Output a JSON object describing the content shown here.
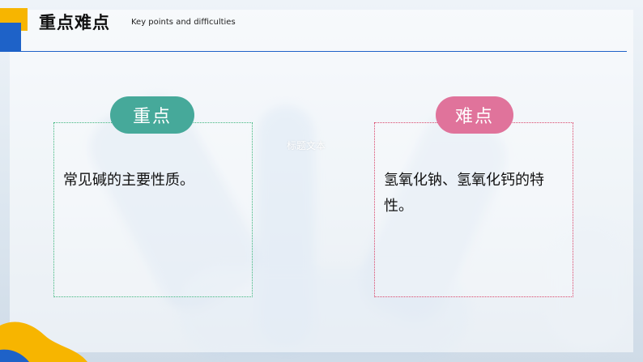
{
  "header": {
    "title": "重点难点",
    "subtitle": "Key points and difficulties"
  },
  "key_point": {
    "label": "重点",
    "text": "常见碱的主要性质。"
  },
  "difficulty": {
    "label": "难点",
    "text": "氢氧化钠、氢氧化钙的特性。"
  },
  "placeholder_text": "标题文本",
  "colors": {
    "accent_blue": "#1e62c8",
    "accent_yellow": "#f7b500",
    "key_point_green": "#46a99a",
    "difficulty_pink": "#e0739b"
  }
}
